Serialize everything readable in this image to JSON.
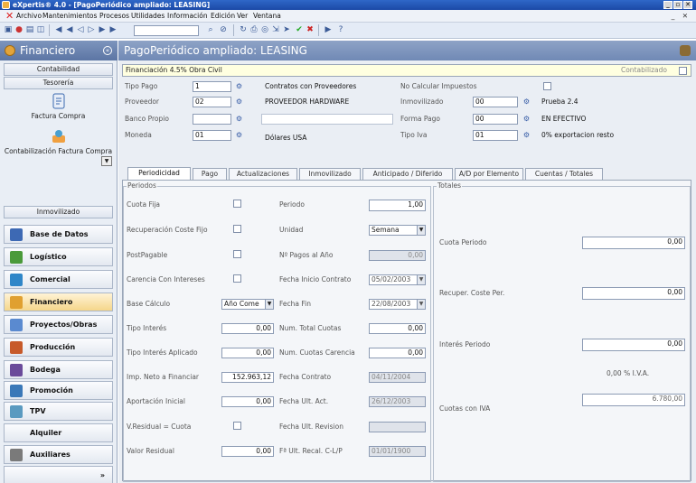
{
  "window": {
    "title": "eXpertis® 4.0 - [PagoPeriódico ampliado: LEASING]"
  },
  "menu": {
    "items": [
      "Archivo",
      "Mantenimientos",
      "Procesos",
      "Utilidades",
      "Información",
      "Edición",
      "Ver",
      "Ventana"
    ],
    "mdi_controls": "_ ✕"
  },
  "nav": {
    "header": "Financiero",
    "sub_contabilidad": "Contabilidad",
    "sub_tesoreria": "Tesorería",
    "factura_compra": "Factura Compra",
    "contab_factura_compra": "Contabilización Factura Compra",
    "sub_inmovilizado": "Inmovilizado",
    "modules": [
      {
        "label": "Base de Datos",
        "color": "#3d69b4"
      },
      {
        "label": "Logístico",
        "color": "#4a9a3a"
      },
      {
        "label": "Comercial",
        "color": "#2f86c8"
      },
      {
        "label": "Financiero",
        "color": "#e0a030"
      },
      {
        "label": "Proyectos/Obras",
        "color": "#5a8ad0"
      },
      {
        "label": "Producción",
        "color": "#c75a2a"
      },
      {
        "label": "Bodega",
        "color": "#6a4a9a"
      },
      {
        "label": "Promoción",
        "color": "#3a78b8"
      },
      {
        "label": "TPV",
        "color": "#5a9ac0"
      },
      {
        "label": "Alquiler",
        "color": ""
      },
      {
        "label": "Auxiliares",
        "color": "#7a7a7a"
      }
    ],
    "more": "»"
  },
  "main": {
    "title": "PagoPeriódico ampliado: LEASING",
    "description": "Financiación 4.5% Obra Civil",
    "contabilizado_label": "Contabilizado",
    "tipo_pago": {
      "label": "Tipo Pago",
      "value": "1",
      "desc": "Contratos con Proveedores"
    },
    "proveedor": {
      "label": "Proveedor",
      "value": "02",
      "desc": "PROVEEDOR HARDWARE"
    },
    "banco_propio": {
      "label": "Banco Propio",
      "value": ""
    },
    "moneda": {
      "label": "Moneda",
      "value": "01",
      "desc": "Dólares USA"
    },
    "no_calcular": {
      "label": "No Calcular Impuestos"
    },
    "inmovilizado": {
      "label": "Inmovilizado",
      "value": "00",
      "desc": "Prueba 2.4"
    },
    "forma_pago": {
      "label": "Forma Pago",
      "value": "00",
      "desc": "EN EFECTIVO"
    },
    "tipo_iva": {
      "label": "Tipo Iva",
      "value": "01",
      "desc": "0%  exportacion resto"
    }
  },
  "tabs": [
    "Periodicidad",
    "Pago",
    "Actualizaciones",
    "Inmovilizado",
    "Anticipado / Diferido",
    "A/D por Elemento",
    "Cuentas / Totales"
  ],
  "periodos": {
    "group_label": "Periodos",
    "cuota_fija": "Cuota Fija",
    "recuperacion": "Recuperación Coste Fijo",
    "postpagable": "PostPagable",
    "carencia": "Carencia Con Intereses",
    "base_calculo": {
      "label": "Base Cálculo",
      "value": "Año Come"
    },
    "tipo_interes": {
      "label": "Tipo Interés",
      "value": "0,00"
    },
    "tipo_interes_aplicado": {
      "label": "Tipo Interés Aplicado",
      "value": "0,00"
    },
    "imp_neto": {
      "label": "Imp. Neto a Financiar",
      "value": "152.963,12"
    },
    "aportacion": {
      "label": "Aportación Inicial",
      "value": "0,00"
    },
    "vresidual_cuota": "V.Residual = Cuota",
    "valor_residual": {
      "label": "Valor Residual",
      "value": "0,00"
    },
    "periodo": {
      "label": "Periodo",
      "value": "1,00"
    },
    "unidad": {
      "label": "Unidad",
      "value": "Semana"
    },
    "pagos_anio": {
      "label": "Nº Pagos al Año",
      "value": "0,00"
    },
    "fecha_inicio": {
      "label": "Fecha Inicio Contrato",
      "value": "05/02/2003"
    },
    "fecha_fin": {
      "label": "Fecha Fin",
      "value": "22/08/2003"
    },
    "num_total_cuotas": {
      "label": "Num. Total Cuotas",
      "value": "0,00"
    },
    "num_cuotas_carencia": {
      "label": "Num. Cuotas Carencia",
      "value": "0,00"
    },
    "fecha_contrato": {
      "label": "Fecha Contrato",
      "value": "04/11/2004"
    },
    "fecha_ult_act": {
      "label": "Fecha Ult. Act.",
      "value": "26/12/2003"
    },
    "fecha_ult_revision": {
      "label": "Fecha Ult. Revision",
      "value": ""
    },
    "fecha_ult_recal": {
      "label": "Fª Ult. Recal. C-L/P",
      "value": "01/01/1900"
    }
  },
  "totales": {
    "group_label": "Totales",
    "cuota_periodo": {
      "label": "Cuota Periodo",
      "value": "0,00"
    },
    "recuper_coste": {
      "label": "Recuper. Coste Per.",
      "value": "0,00"
    },
    "interes_periodo": {
      "label": "Interés Periodo",
      "value": "0,00"
    },
    "iva_text": "0,00 % I.V.A.",
    "cuotas_con_iva": {
      "label": "Cuotas con IVA",
      "value": "6.780,00"
    }
  }
}
